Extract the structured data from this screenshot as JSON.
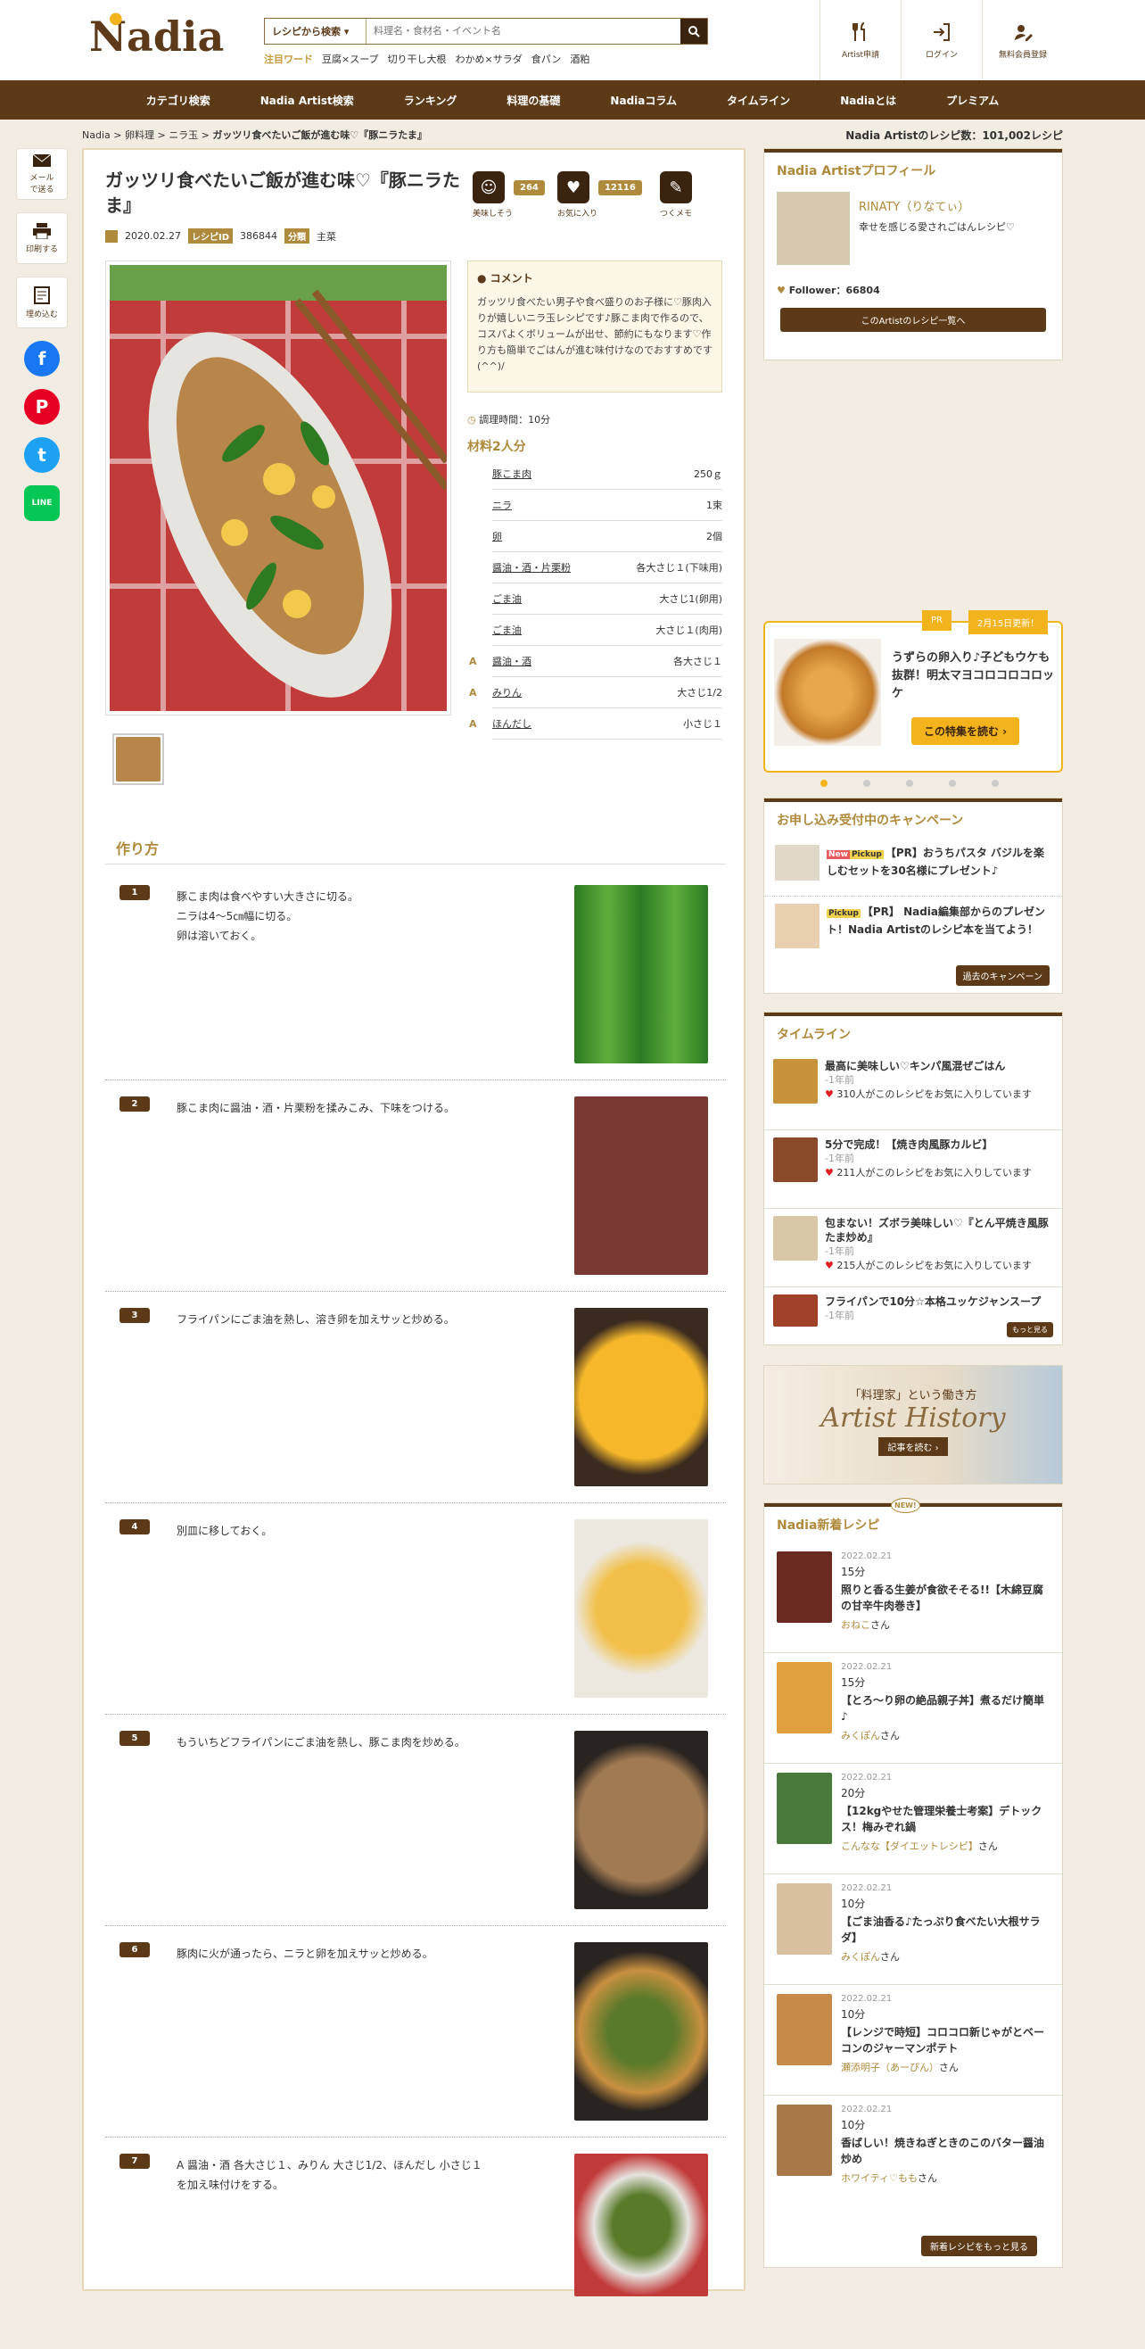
{
  "header": {
    "logo": "Nadia",
    "search_mode": "レシピから検索",
    "search_placeholder": "料理名・食材名・イベント名",
    "hot_label": "注目ワード",
    "hot_words": [
      "豆腐×スープ",
      "切り干し大根",
      "わかめ×サラダ",
      "食パン",
      "酒粕"
    ],
    "buttons": [
      "Artist申請",
      "ログイン",
      "無料会員登録"
    ]
  },
  "nav": [
    "カテゴリ検索",
    "Nadia Artist検索",
    "ランキング",
    "料理の基礎",
    "Nadiaコラム",
    "タイムライン",
    "Nadiaとは",
    "プレミアム"
  ],
  "breadcrumb": [
    "Nadia",
    "卵料理",
    "ニラ玉",
    "ガッツリ食べたいご飯が進む味♡『豚ニラたま』"
  ],
  "recipe_count": "Nadia Artistのレシピ数：101,002レシピ",
  "share": {
    "mail": "メール\nで送る",
    "print": "印刷する",
    "embed": "埋め込む",
    "line": "LINE"
  },
  "recipe": {
    "title": "ガッツリ食べたいご飯が進む味♡『豚ニラたま』",
    "date": "2020.02.27",
    "id_label": "レシピID",
    "id": "386844",
    "cat_label": "分類",
    "category": "主菜",
    "oishisou": "美味しそう",
    "oishisou_count": "264",
    "fav": "お気に入り",
    "fav_count": "12116",
    "tsukumemo": "つくメモ",
    "comment_title": "コメント",
    "comment": "ガッツリ食べたい男子や食べ盛りのお子様に♡豚肉入りが嬉しいニラ玉レシピです♪豚こま肉で作るので、コスパよくボリュームが出せ、節約にもなります♡作り方も簡単でごはんが進む味付けなのでおすすめです(^^)/",
    "time": "調理時間：10分",
    "ing_title": "材料2人分",
    "ingredients": [
      {
        "g": "",
        "n": "豚こま肉",
        "q": "250ｇ"
      },
      {
        "g": "",
        "n": "ニラ",
        "q": "1束"
      },
      {
        "g": "",
        "n": "卵",
        "q": "2個"
      },
      {
        "g": "",
        "n": "醤油・酒・片栗粉",
        "q": "各大さじ１(下味用)"
      },
      {
        "g": "",
        "n": "ごま油",
        "q": "大さじ1(卵用)"
      },
      {
        "g": "",
        "n": "ごま油",
        "q": "大さじ１(肉用)"
      },
      {
        "g": "A",
        "n": "醤油・酒",
        "q": "各大さじ１"
      },
      {
        "g": "A",
        "n": "みりん",
        "q": "大さじ1/2"
      },
      {
        "g": "A",
        "n": "ほんだし",
        "q": "小さじ１"
      }
    ],
    "steps_title": "作り方",
    "steps": [
      {
        "n": "1",
        "t": "豚こま肉は食べやすい大きさに切る。\nニラは4～5㎝幅に切る。\n卵は溶いておく。"
      },
      {
        "n": "2",
        "t": "豚こま肉に醤油・酒・片栗粉を揉みこみ、下味をつける。"
      },
      {
        "n": "3",
        "t": "フライパンにごま油を熱し、溶き卵を加えサッと炒める。"
      },
      {
        "n": "4",
        "t": "別皿に移しておく。"
      },
      {
        "n": "5",
        "t": "もういちどフライパンにごま油を熱し、豚こま肉を炒める。"
      },
      {
        "n": "6",
        "t": "豚肉に火が通ったら、ニラと卵を加えサッと炒める。"
      },
      {
        "n": "7",
        "t": "A 醤油・酒 各大さじ１、みりん 大さじ1/2、ほんだし 小さじ１\nを加え味付けをする。"
      }
    ]
  },
  "profile": {
    "title": "Nadia Artistプロフィール",
    "name": "RINATY（りなてぃ）",
    "desc": "幸せを感じる愛されごはんレシピ♡",
    "follower": "Follower：66804",
    "button": "このArtistのレシピ一覧へ"
  },
  "pr": {
    "badge": "PR",
    "date": "2月15日更新！",
    "text": "うずらの卵入り♪子どもウケも抜群！明太マヨコロコロコロッケ",
    "button": "この特集を読む ›"
  },
  "campaign": {
    "title": "お申し込み受付中のキャンペーン",
    "items": [
      {
        "tags": [
          "New",
          "Pickup"
        ],
        "t": "【PR】おうちパスタ バジルを楽しむセットを30名様にプレゼント♪"
      },
      {
        "tags": [
          "Pickup"
        ],
        "t": "【PR】 Nadia編集部からのプレゼント！Nadia Artistのレシピ本を当てよう！"
      }
    ],
    "button": "過去のキャンペーン"
  },
  "timeline": {
    "title": "タイムライン",
    "items": [
      {
        "t": "最高に美味しい♡キンパ風混ぜごはん",
        "ago": "-1年前",
        "s": "310人がこのレシピをお気に入りしています"
      },
      {
        "t": "5分で完成！【焼き肉風豚カルビ】",
        "ago": "-1年前",
        "s": "211人がこのレシピをお気に入りしています"
      },
      {
        "t": "包まない！ズボラ美味しい♡『とん平焼き風豚たま炒め』",
        "ago": "-1年前",
        "s": "215人がこのレシピをお気に入りしています"
      },
      {
        "t": "フライパンで10分☆本格ユッケジャンスープ",
        "ago": "-1年前",
        "s": ""
      }
    ],
    "more": "もっと見る"
  },
  "banner": {
    "sub": "「料理家」という働き方",
    "title": "Artist History",
    "btn": "記事を読む ›"
  },
  "new_recipes": {
    "title": "Nadia新着レシピ",
    "badge": "NEW!",
    "items": [
      {
        "d": "2022.02.21",
        "m": "15分",
        "t": "照りと香る生姜が食欲そそる!!【木綿豆腐の甘辛牛肉巻き】",
        "a": "おねこ",
        "s": "さん"
      },
      {
        "d": "2022.02.21",
        "m": "15分",
        "t": "【とろ〜り卵の絶品親子丼】煮るだけ簡単♪",
        "a": "みくぽん",
        "s": "さん"
      },
      {
        "d": "2022.02.21",
        "m": "20分",
        "t": "【12kgやせた管理栄養士考案】デトックス！梅みぞれ鍋",
        "a": "こんなな【ダイエットレシピ】",
        "s": "さん"
      },
      {
        "d": "2022.02.21",
        "m": "10分",
        "t": "【ごま油香る♪たっぷり食べたい大根サラダ】",
        "a": "みくぽん",
        "s": "さん"
      },
      {
        "d": "2022.02.21",
        "m": "10分",
        "t": "【レンジで時短】コロコロ新じゃがとベーコンのジャーマンポテト",
        "a": "瀬添明子（あーぴん）",
        "s": "さん"
      },
      {
        "d": "2022.02.21",
        "m": "10分",
        "t": "香ばしい！焼きねぎときのこのバター醤油炒め",
        "a": "ホワイティ♡もも",
        "s": "さん"
      }
    ],
    "more": "新着レシピをもっと見る"
  }
}
